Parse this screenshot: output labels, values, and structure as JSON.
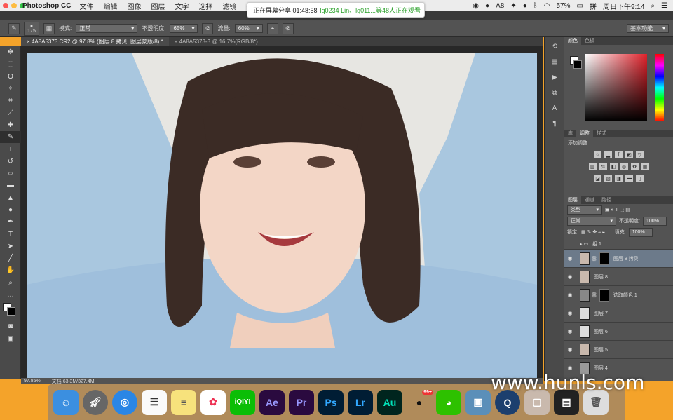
{
  "menubar": {
    "app_name": "Photoshop CC",
    "items": [
      "文件",
      "编辑",
      "图像",
      "图层",
      "文字",
      "选择",
      "滤镜",
      "3D"
    ],
    "right": {
      "battery": "57%",
      "clock": "周日下午9:14",
      "status_b": "8"
    }
  },
  "share_bar": {
    "label": "正在屏幕分享 01:48:58",
    "viewers": "lq0234 Lin、lq011...等48人正在观看"
  },
  "options_bar": {
    "brush_size": "175",
    "mode_label": "模式:",
    "mode_value": "正常",
    "opacity_label": "不透明度:",
    "opacity_value": "65%",
    "flow_label": "流量:",
    "flow_value": "60%",
    "workspace": "基本功能"
  },
  "tabs": [
    {
      "label": "4A8A5373.CR2 @ 97.8% (图层 8 拷贝, 图层蒙版/8) *"
    },
    {
      "label": "4A8A5373-3 @ 16.7%(RGB/8*)"
    }
  ],
  "status": {
    "zoom": "97.85%",
    "doc": "文档:63.3M/327.4M"
  },
  "panels": {
    "color_tabs": [
      "颜色",
      "色板"
    ],
    "adjust_tabs": [
      "库",
      "调整",
      "样式"
    ],
    "adjust_title": "添加调整",
    "layers_tabs": [
      "图层",
      "通道",
      "路径"
    ],
    "filter_kind": "类型",
    "blend_mode": "正常",
    "opacity_label": "不透明度:",
    "opacity_value": "100%",
    "lock_label": "锁定:",
    "fill_label": "填充:",
    "fill_value": "100%",
    "layers": [
      {
        "name": "组 1",
        "type": "group"
      },
      {
        "name": "图层 8 拷贝",
        "type": "masked",
        "selected": true
      },
      {
        "name": "图层 8",
        "type": "photo"
      },
      {
        "name": "选取颜色 1",
        "type": "adjust"
      },
      {
        "name": "图层 7",
        "type": "blank"
      },
      {
        "name": "图层 6",
        "type": "blank"
      },
      {
        "name": "图层 5",
        "type": "photo"
      },
      {
        "name": "图层 4",
        "type": "blank"
      }
    ]
  },
  "dock": {
    "apps": [
      "Finder",
      "Launchpad",
      "Safari",
      "Reminders",
      "Notes",
      "Photos",
      "iQIYI",
      "Ae",
      "Pr",
      "Ps",
      "Lr",
      "Au",
      "QQ",
      "WeChat",
      "Preview",
      "QuickTime",
      "Photo",
      "Browser",
      "Trash"
    ],
    "qq_badge": "99+"
  },
  "watermark": "www.hunls.com",
  "colors": {
    "accent": "#6c7a8a",
    "ps_blue": "#31a8ff",
    "pr": "#9999ff",
    "ae": "#9999ff",
    "lr": "#31a8ff",
    "au": "#00e4bb"
  }
}
